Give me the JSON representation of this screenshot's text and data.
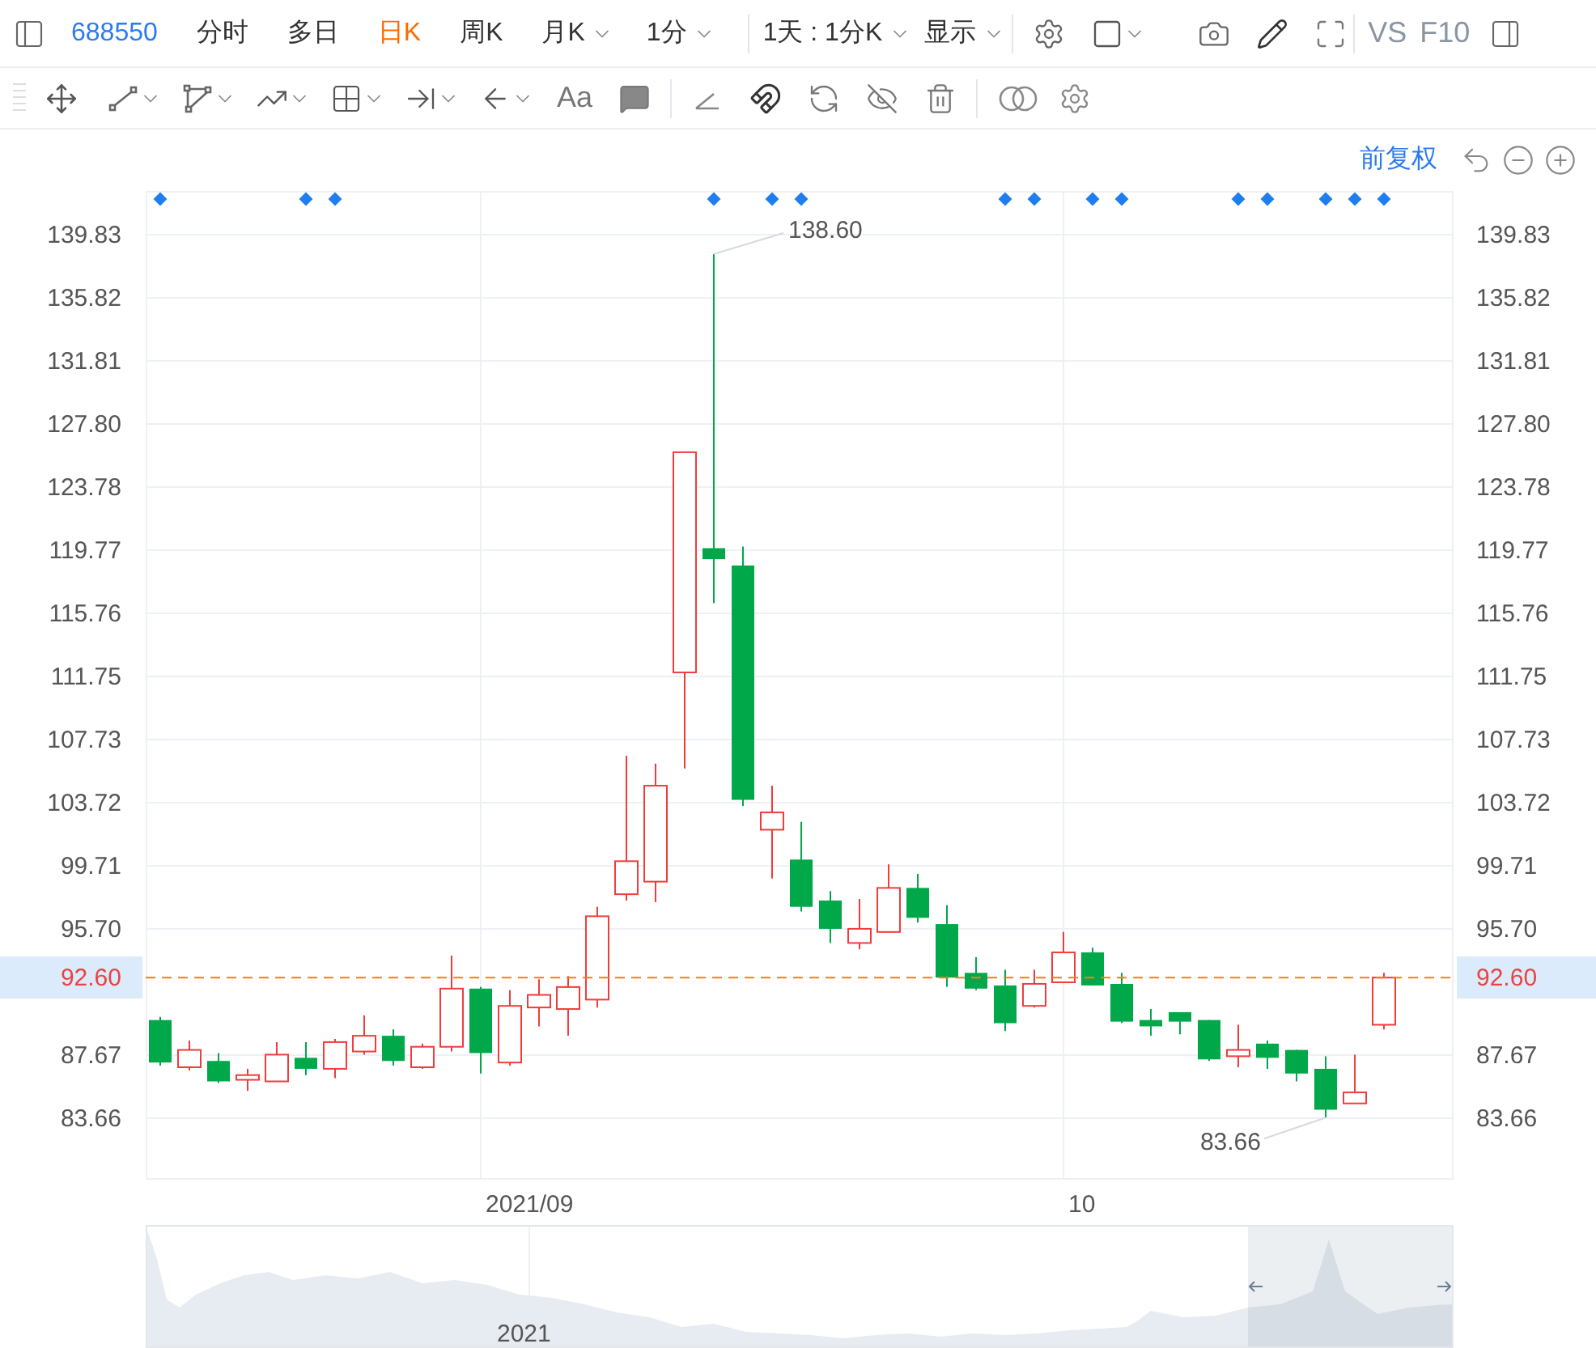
{
  "header": {
    "stock_code": "688550",
    "periods": [
      {
        "label": "分时",
        "selected": false,
        "dropdown": false
      },
      {
        "label": "多日",
        "selected": false,
        "dropdown": false
      },
      {
        "label": "日K",
        "selected": true,
        "dropdown": false
      },
      {
        "label": "周K",
        "selected": false,
        "dropdown": false
      },
      {
        "label": "月K",
        "selected": false,
        "dropdown": true
      },
      {
        "label": "1分",
        "selected": false,
        "dropdown": true
      }
    ],
    "interval": "1天 : 1分K",
    "display": "显示",
    "vs": "VS",
    "f10": "F10"
  },
  "drawing_toolbar": {
    "text_tool": "Aa"
  },
  "chart": {
    "adjust": "前复权",
    "price_line": {
      "left_label": "92.60",
      "right_label": "92.60"
    },
    "right_axis": [
      "139.83",
      "135.82",
      "131.81",
      "127.80",
      "123.78",
      "119.77",
      "115.76",
      "111.75",
      "107.73",
      "103.72",
      "99.71",
      "95.70",
      "87.67",
      "83.66"
    ],
    "event_markers": [
      true,
      false,
      false,
      false,
      false,
      true,
      true,
      false,
      false,
      false,
      false,
      false,
      false,
      false,
      false,
      false,
      false,
      false,
      false,
      true,
      false,
      true,
      true,
      false,
      false,
      false,
      false,
      false,
      false,
      true,
      true,
      false,
      true,
      true,
      false,
      false,
      false,
      true,
      true,
      false,
      true,
      true,
      true
    ],
    "month_start": [
      false,
      false,
      false,
      false,
      false,
      false,
      false,
      false,
      false,
      false,
      false,
      true,
      false,
      false,
      false,
      false,
      false,
      false,
      false,
      false,
      false,
      false,
      false,
      false,
      false,
      false,
      false,
      false,
      false,
      false,
      false,
      true,
      false,
      false,
      false,
      false,
      false,
      false,
      false,
      false,
      false,
      false,
      false
    ],
    "month_labels": [
      "2021/09",
      "10"
    ],
    "chart_data": {
      "type": "candlestick",
      "ylim": [
        79.75,
        142.61
      ],
      "grid": true,
      "yticks": [
        {
          "value": 139.83,
          "label": "139.83"
        },
        {
          "value": 135.82,
          "label": "135.82"
        },
        {
          "value": 131.81,
          "label": "131.81"
        },
        {
          "value": 127.8,
          "label": "127.80"
        },
        {
          "value": 123.78,
          "label": "123.78"
        },
        {
          "value": 119.77,
          "label": "119.77"
        },
        {
          "value": 115.76,
          "label": "115.76"
        },
        {
          "value": 111.75,
          "label": "111.75"
        },
        {
          "value": 107.73,
          "label": "107.73"
        },
        {
          "value": 103.72,
          "label": "103.72"
        },
        {
          "value": 99.71,
          "label": "99.71"
        },
        {
          "value": 95.7,
          "label": "95.70"
        },
        {
          "value": 87.67,
          "label": "87.67"
        },
        {
          "value": 83.66,
          "label": "83.66"
        }
      ],
      "ref_lines": [
        {
          "axis": "y",
          "value": 92.6,
          "color": "#ff7a1a"
        }
      ],
      "ohlc": [
        [
          89.9,
          90.1,
          87.0,
          87.2
        ],
        [
          86.9,
          88.6,
          86.7,
          88.0
        ],
        [
          87.3,
          87.8,
          85.9,
          86.0
        ],
        [
          86.1,
          86.8,
          85.4,
          86.4
        ],
        [
          86.0,
          88.5,
          86.0,
          87.7
        ],
        [
          87.5,
          88.5,
          86.4,
          86.8
        ],
        [
          86.8,
          88.7,
          86.2,
          88.5
        ],
        [
          87.9,
          90.2,
          87.7,
          88.9
        ],
        [
          88.9,
          89.3,
          87.0,
          87.3
        ],
        [
          86.9,
          88.4,
          86.8,
          88.2
        ],
        [
          88.2,
          94.0,
          87.9,
          91.9
        ],
        [
          91.9,
          92.0,
          86.5,
          87.8
        ],
        [
          87.2,
          91.8,
          87.0,
          90.8
        ],
        [
          90.7,
          92.5,
          89.5,
          91.5
        ],
        [
          90.6,
          92.7,
          88.9,
          92.0
        ],
        [
          91.2,
          97.1,
          90.7,
          96.5
        ],
        [
          97.9,
          106.7,
          97.5,
          100.0
        ],
        [
          98.7,
          106.2,
          97.4,
          104.8
        ],
        [
          112.0,
          126.0,
          105.9,
          126.0
        ],
        [
          119.9,
          138.6,
          116.4,
          119.2
        ],
        [
          118.8,
          120.0,
          103.5,
          103.9
        ],
        [
          102.0,
          104.8,
          98.9,
          103.1
        ],
        [
          100.1,
          102.5,
          96.8,
          97.1
        ],
        [
          97.5,
          98.1,
          94.8,
          95.7
        ],
        [
          94.8,
          97.6,
          94.4,
          95.7
        ],
        [
          95.5,
          99.8,
          95.5,
          98.3
        ],
        [
          98.3,
          99.2,
          96.1,
          96.4
        ],
        [
          96.0,
          97.2,
          92.0,
          92.6
        ],
        [
          92.9,
          93.9,
          91.8,
          91.9
        ],
        [
          92.1,
          93.1,
          89.2,
          89.7
        ],
        [
          90.8,
          93.1,
          90.7,
          92.2
        ],
        [
          92.3,
          95.5,
          92.3,
          94.2
        ],
        [
          94.2,
          94.5,
          92.1,
          92.1
        ],
        [
          92.2,
          92.9,
          89.7,
          89.8
        ],
        [
          89.9,
          90.6,
          88.9,
          89.5
        ],
        [
          90.4,
          90.4,
          89.0,
          89.8
        ],
        [
          89.9,
          89.9,
          87.3,
          87.4
        ],
        [
          87.6,
          89.6,
          86.9,
          88.0
        ],
        [
          88.4,
          88.6,
          86.8,
          87.5
        ],
        [
          88.0,
          88.0,
          86.0,
          86.5
        ],
        [
          86.8,
          87.6,
          83.7,
          84.2
        ],
        [
          84.6,
          87.7,
          84.6,
          85.3
        ],
        [
          89.6,
          92.9,
          89.3,
          92.6
        ]
      ],
      "annotations": [
        "138.60",
        "83.66"
      ]
    },
    "navigator": {
      "year_label": "2021"
    }
  }
}
